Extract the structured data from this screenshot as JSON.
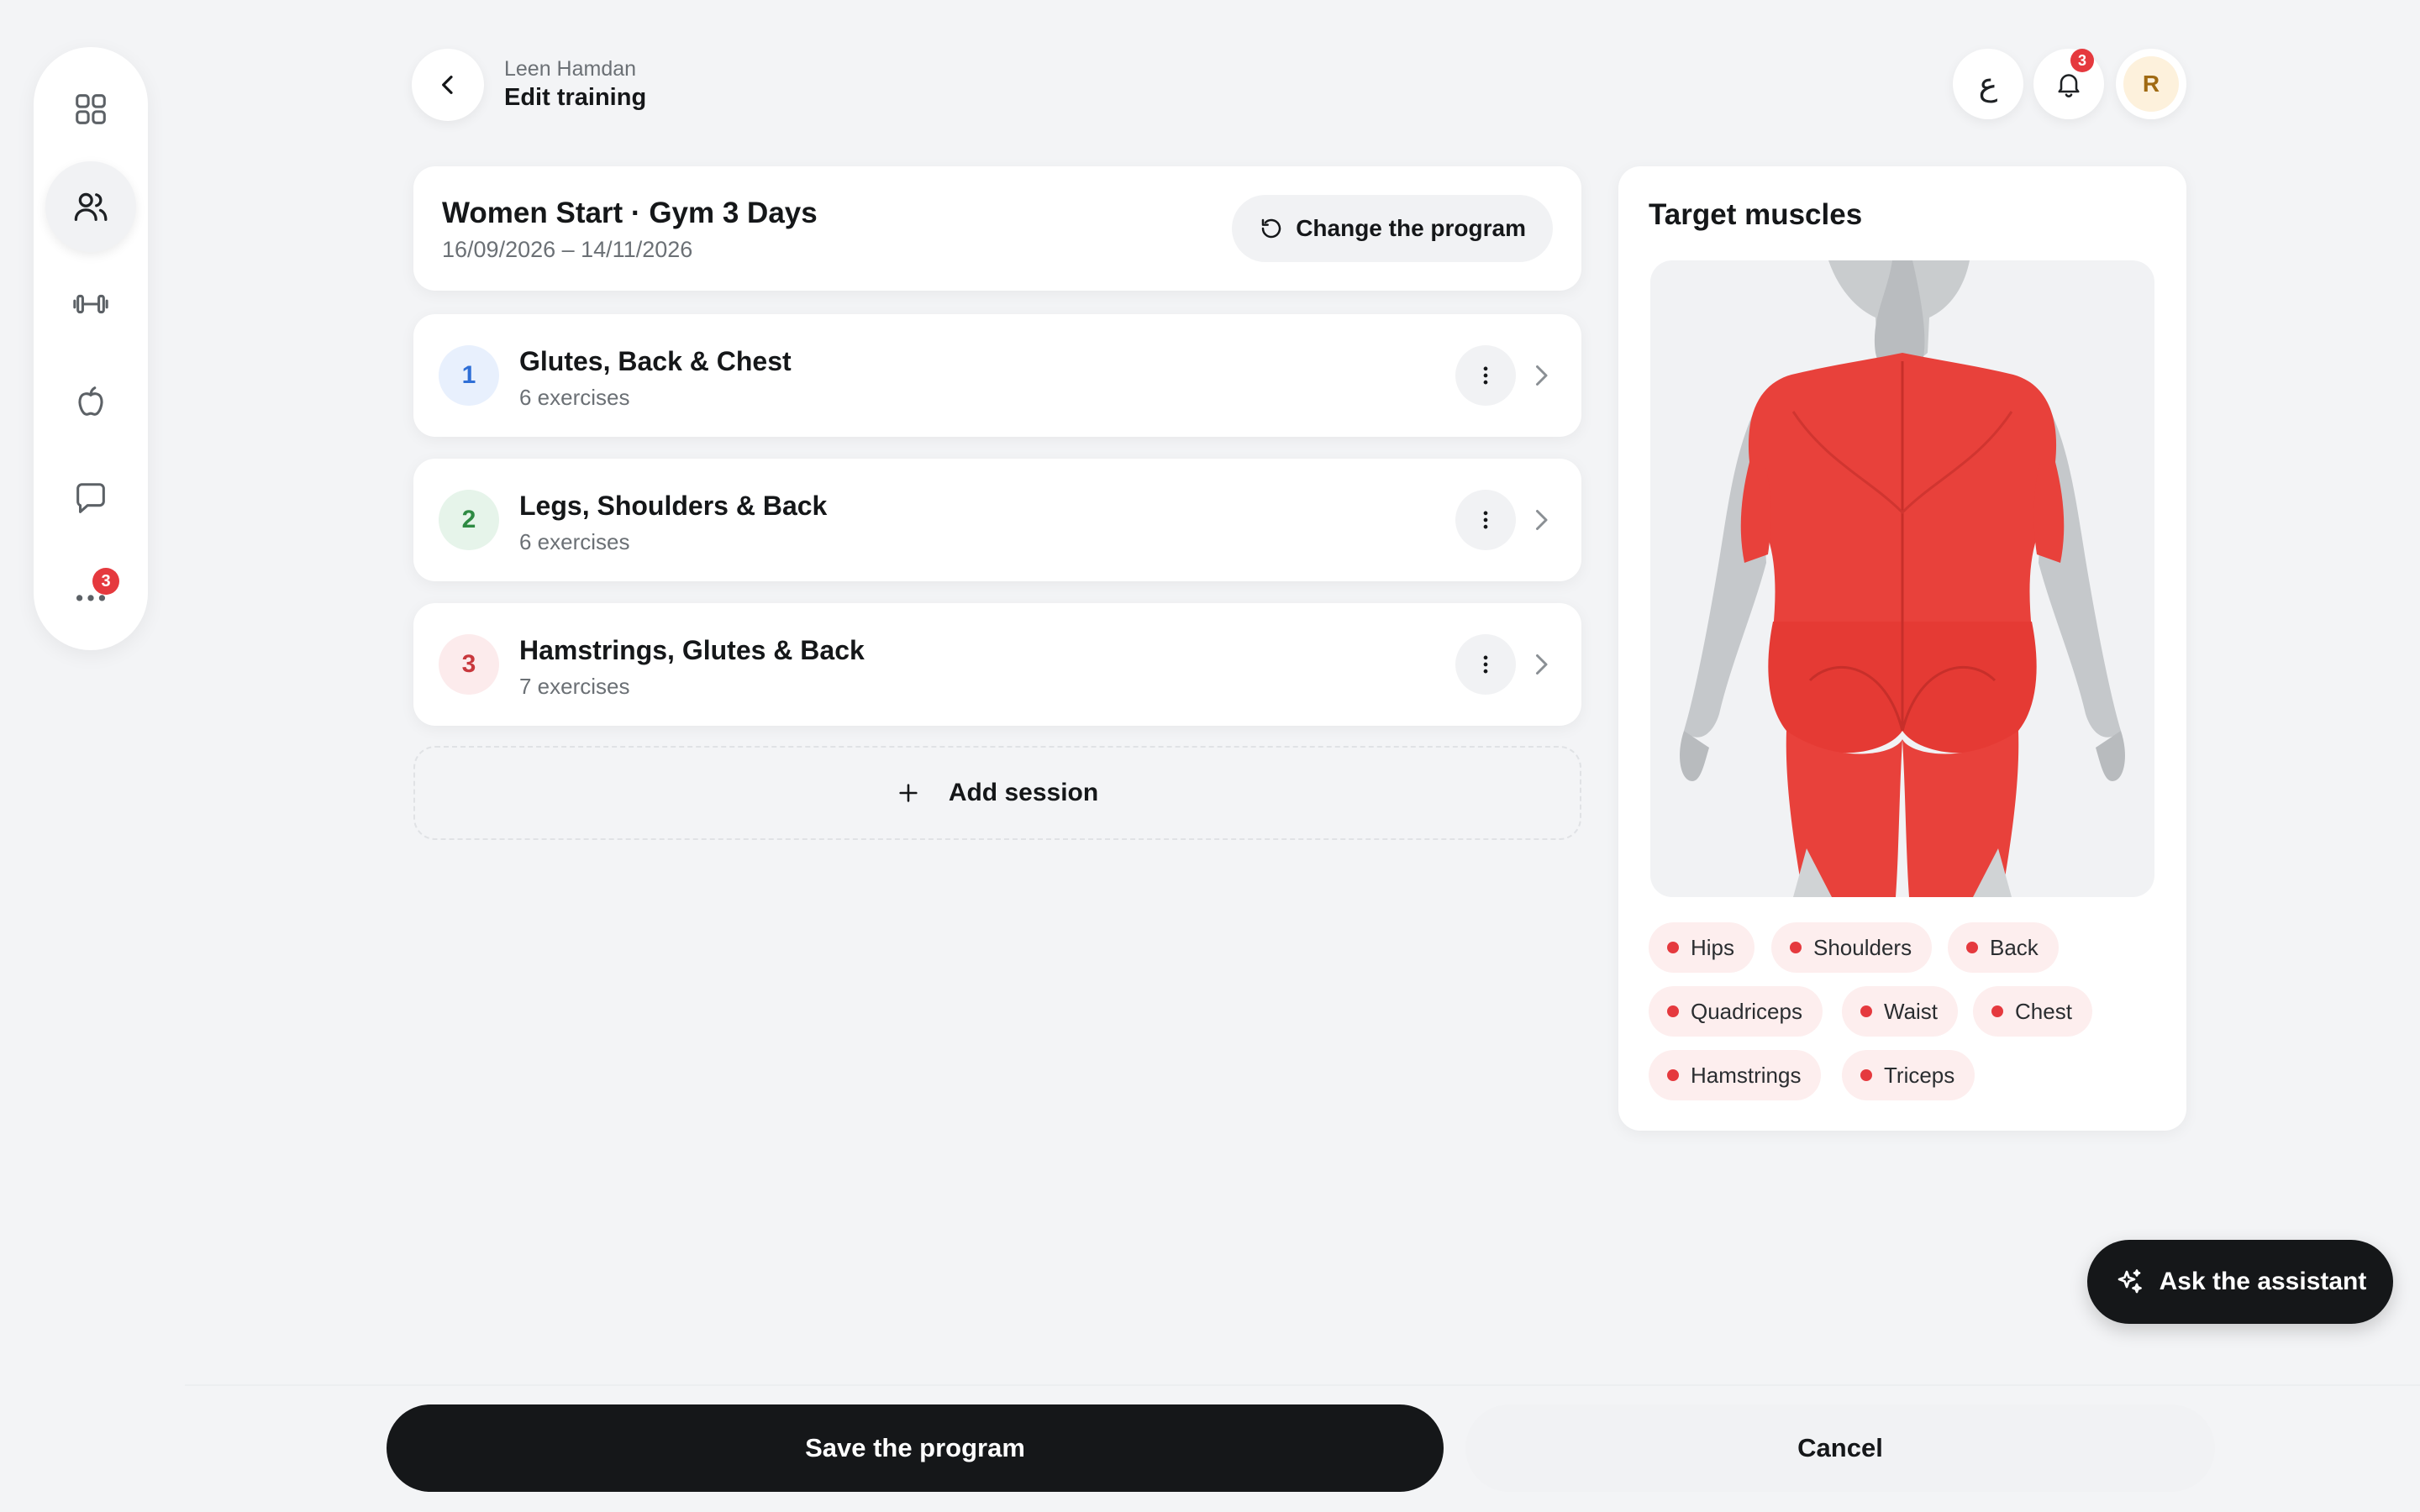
{
  "sidebar": {
    "items": [
      {
        "name": "dashboard"
      },
      {
        "name": "clients",
        "active": true
      },
      {
        "name": "workouts"
      },
      {
        "name": "nutrition"
      },
      {
        "name": "messages"
      },
      {
        "name": "more",
        "badge": "3"
      }
    ]
  },
  "header": {
    "user_name": "Leen Hamdan",
    "title": "Edit training",
    "language_glyph": "ع",
    "notifications_badge": "3",
    "avatar_initial": "R"
  },
  "program": {
    "title": "Women Start · Gym 3 Days",
    "dates": "16/09/2026 – 14/11/2026",
    "change_label": "Change the program"
  },
  "sessions": [
    {
      "number": "1",
      "title": "Glutes, Back & Chest",
      "subtitle": "6 exercises",
      "color": "#2f6fd6",
      "bg": "#e8f0fd"
    },
    {
      "number": "2",
      "title": "Legs, Shoulders & Back",
      "subtitle": "6 exercises",
      "color": "#2e8a43",
      "bg": "#e6f4ea"
    },
    {
      "number": "3",
      "title": "Hamstrings, Glutes & Back",
      "subtitle": "7 exercises",
      "color": "#c8383d",
      "bg": "#fcebec"
    }
  ],
  "add_session_label": "Add session",
  "muscles": {
    "title": "Target muscles",
    "chips": [
      "Hips",
      "Shoulders",
      "Back",
      "Quadriceps",
      "Waist",
      "Chest",
      "Hamstrings",
      "Triceps"
    ],
    "highlight_color": "#e8413b"
  },
  "assistant_label": "Ask the assistant",
  "footer": {
    "save_label": "Save the program",
    "cancel_label": "Cancel"
  }
}
